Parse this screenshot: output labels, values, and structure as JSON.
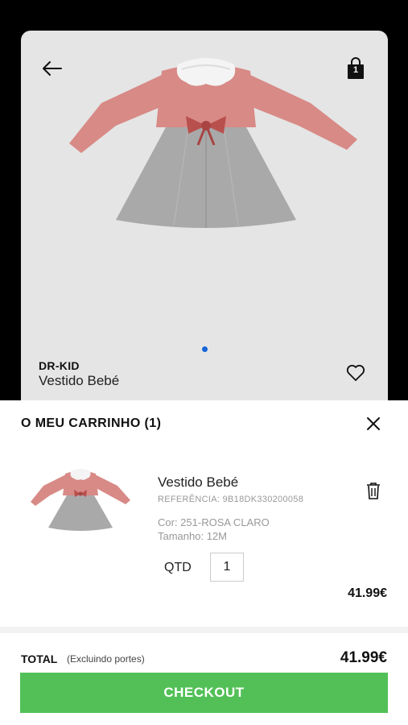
{
  "product": {
    "brand": "DR-KID",
    "name": "Vestido Bebé",
    "bag_count": "1",
    "carousel_dots": 1
  },
  "cart": {
    "title": "O MEU CARRINHO (1)",
    "item": {
      "name": "Vestido Bebé",
      "reference": "REFERÊNCIA: 9B18DK330200058",
      "color": "Cor: 251-ROSA CLARO",
      "size": "Tamanho: 12M",
      "qty_label": "QTD",
      "qty_value": "1",
      "price": "41.99€"
    },
    "total_label": "TOTAL",
    "total_note": "(Excluindo portes)",
    "total_value": "41.99€",
    "checkout_label": "CHECKOUT"
  },
  "colors": {
    "checkout_green": "#52c057",
    "dot_blue": "#1565d8",
    "dress_pink": "#d88a86",
    "dress_grey": "#a9a9a9"
  },
  "icons": [
    "arrow-left-icon",
    "shopping-bag-icon",
    "heart-icon",
    "close-icon",
    "trash-icon"
  ]
}
